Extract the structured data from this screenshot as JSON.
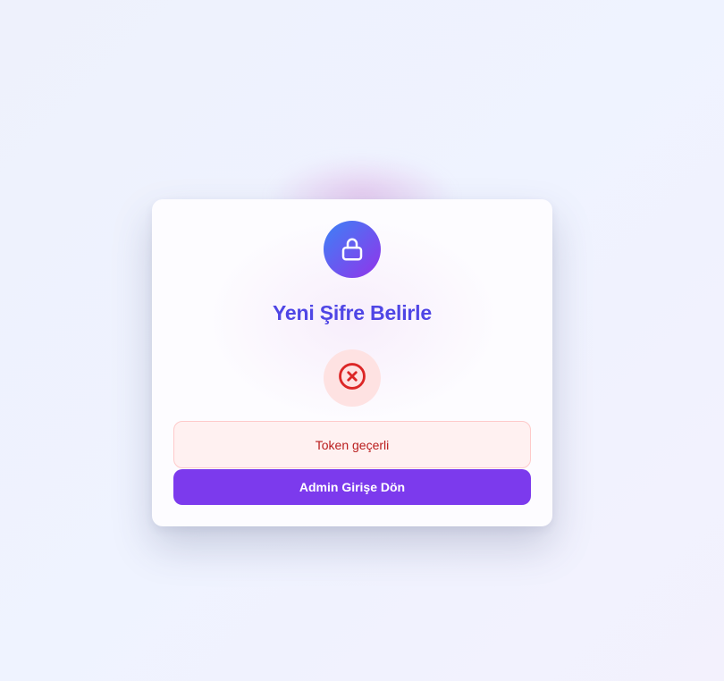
{
  "page": {
    "title": "Yeni Şifre Belirle"
  },
  "icons": {
    "header": "lock-icon",
    "status": "error-circle-x-icon"
  },
  "status": {
    "message": "Token geçerli"
  },
  "actions": {
    "back_label": "Admin Girişe Dön"
  },
  "colors": {
    "accent": "#7c3aed",
    "title": "#4f46e5",
    "gradient_start": "#3b82f6",
    "gradient_end": "#9333ea",
    "error": "#dc2626",
    "error_bg": "#fee2e2",
    "message_text": "#b91c1c",
    "message_bg": "#fff1f1",
    "message_border": "#fecaca"
  }
}
